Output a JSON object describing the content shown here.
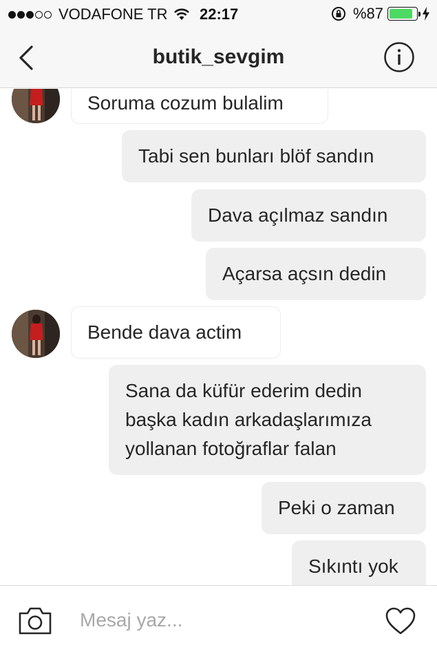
{
  "status_bar": {
    "carrier": "VODAFONE TR",
    "time": "22:17",
    "battery": "%87",
    "battery_level": 0.87,
    "signal_bars": 3
  },
  "header": {
    "back_icon": "chevron-left-icon",
    "title": "butik_sevgim",
    "info_icon": "info-icon"
  },
  "messages": [
    {
      "direction": "incoming",
      "text": "Soruma cozum bulalim"
    },
    {
      "direction": "outgoing",
      "text": "Tabi sen bunları blöf sandın"
    },
    {
      "direction": "outgoing",
      "text": "Dava açılmaz sandın"
    },
    {
      "direction": "outgoing",
      "text": "Açarsa açsın dedin"
    },
    {
      "direction": "incoming",
      "text": "Bende dava actim"
    },
    {
      "direction": "outgoing",
      "lines": [
        "Sana da küfür ederim dedin",
        "başka kadın arkadaşlarımıza",
        "yollanan fotoğraflar falan"
      ]
    },
    {
      "direction": "outgoing",
      "text": "Peki o zaman"
    },
    {
      "direction": "outgoing",
      "text": "Sıkıntı yok"
    }
  ],
  "composer": {
    "placeholder": "Mesaj yaz...",
    "value": "",
    "camera_icon": "camera-icon",
    "heart_icon": "heart-icon"
  },
  "colors": {
    "outgoing_bubble": "#efefef",
    "incoming_bubble": "#ffffff",
    "battery_fill": "#4cd964",
    "placeholder": "#a8a8a8"
  }
}
